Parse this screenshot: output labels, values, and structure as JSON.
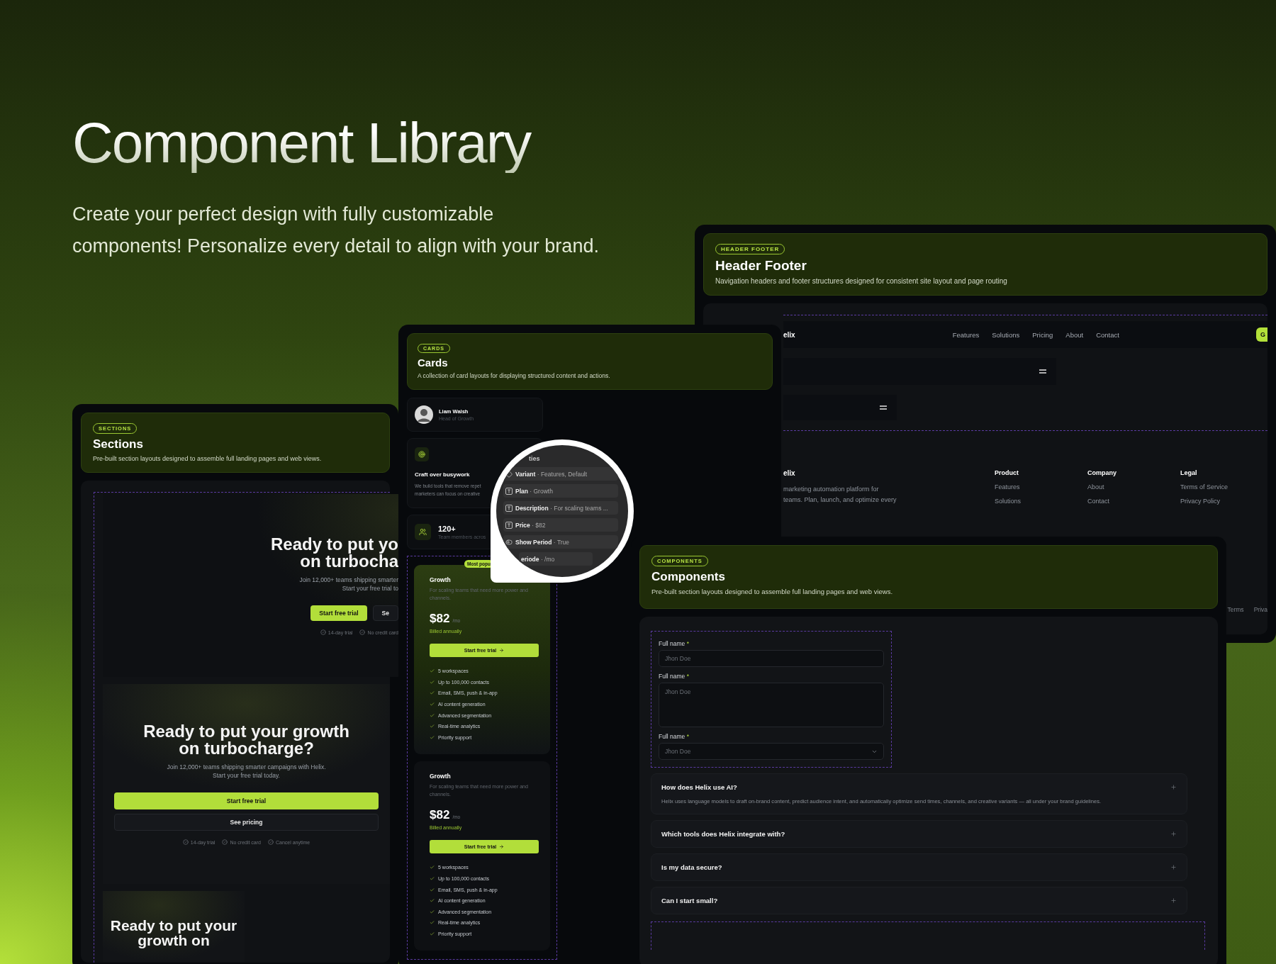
{
  "hero": {
    "title": "Component Library",
    "subtitle": [
      "Create your perfect design with fully customizable",
      "components! Personalize every detail to align with your brand."
    ]
  },
  "header_footer": {
    "badge": "HEADER FOOTER",
    "title": "Header Footer",
    "description": "Navigation headers and footer structures designed for consistent site layout and page routing",
    "nav": {
      "brand": "elix",
      "links": [
        "Features",
        "Solutions",
        "Pricing",
        "About",
        "Contact"
      ],
      "cta": "G"
    },
    "footer": {
      "brand": "elix",
      "description": [
        "marketing automation platform for",
        "teams. Plan, launch, and optimize every"
      ],
      "columns": [
        {
          "title": "Product",
          "links": [
            "Features",
            "Solutions"
          ]
        },
        {
          "title": "Company",
          "links": [
            "About",
            "Contact"
          ]
        },
        {
          "title": "Legal",
          "links": [
            "Terms of Service",
            "Privacy Policy"
          ]
        }
      ],
      "legal_links": [
        "Terms",
        "Priva"
      ]
    }
  },
  "sections": {
    "badge": "SECTIONS",
    "title": "Sections",
    "description": "Pre-built section layouts designed to assemble full landing pages and web views.",
    "blocks": [
      {
        "kind": "cropped",
        "headline": [
          "Ready to put yo",
          "on turbocha"
        ],
        "text": [
          "Join 12,000+ teams shipping smarter",
          "Start your free trial to"
        ],
        "buttons": [
          {
            "label": "Start free trial",
            "primary": true
          },
          {
            "label": "Se",
            "primary": false
          }
        ],
        "perks": [
          "14-day trial",
          "No credit card"
        ]
      },
      {
        "kind": "stacked",
        "headline": [
          "Ready to put your growth",
          "on turbocharge?"
        ],
        "text": [
          "Join 12,000+ teams shipping smarter campaigns with Helix.",
          "Start your free trial today."
        ],
        "buttons": [
          {
            "label": "Start free trial",
            "primary": true
          },
          {
            "label": "See pricing",
            "primary": false
          }
        ],
        "perks": [
          "14-day trial",
          "No credit card",
          "Cancel anytime"
        ]
      },
      {
        "kind": "narrow",
        "headline": [
          "Ready to put your",
          "growth on"
        ]
      }
    ]
  },
  "cards": {
    "badge": "CARDS",
    "title": "Cards",
    "description": "A collection of card layouts for displaying structured content and actions.",
    "profile": {
      "name": "Liam Walsh",
      "role": "Head of Growth"
    },
    "feature": {
      "title": "Craft over busywork",
      "text": [
        "We build tools that remove repet",
        "marketers can focus on creative"
      ]
    },
    "stat": {
      "value": "120+",
      "label": "Team members acros"
    },
    "plans": [
      {
        "featured": true,
        "badge": "Most popu",
        "name": "Growth",
        "description": "For scaling teams that need more power and channels.",
        "price": "$82",
        "period": "/mo",
        "billing": "Billed annually",
        "cta": "Start free trial",
        "features": [
          "5 workspaces",
          "Up to 100,000 contacts",
          "Email, SMS, push & in-app",
          "AI content generation",
          "Advanced segmentation",
          "Real-time analytics",
          "Priority support"
        ]
      },
      {
        "featured": false,
        "name": "Growth",
        "description": "For scaling teams that need more power and channels.",
        "price": "$82",
        "period": "/mo",
        "billing": "Billed annually",
        "cta": "Start free trial",
        "features": [
          "5 workspaces",
          "Up to 100,000 contacts",
          "Email, SMS, push & in-app",
          "AI content generation",
          "Advanced segmentation",
          "Real-time analytics",
          "Priority support"
        ]
      }
    ]
  },
  "magnifier": {
    "heading": "ties",
    "rows": [
      {
        "kind": "variant",
        "text": "**Variant** · Features, Default"
      },
      {
        "kind": "text",
        "text": "**Plan** · Growth"
      },
      {
        "kind": "text",
        "text": "**Description** · For scaling teams ..."
      },
      {
        "kind": "text",
        "text": "**Price** · $82"
      },
      {
        "kind": "toggle",
        "text": "**Show Period** · True"
      },
      {
        "kind": "cut",
        "text": "**eriode** · /mo"
      }
    ]
  },
  "components": {
    "badge": "COMPONENTS",
    "title": "Components",
    "description": "Pre-built section layouts designed to assemble full landing pages and web views.",
    "fields": [
      {
        "kind": "input",
        "label": "Full name",
        "mark": "*",
        "placeholder": "Jhon Doe"
      },
      {
        "kind": "textarea",
        "label": "Full name",
        "mark": "*",
        "placeholder": "Jhon Doe"
      },
      {
        "kind": "select",
        "label": "Full name",
        "mark": "*",
        "placeholder": "Jhon Doe"
      }
    ],
    "faq": [
      {
        "question": "How does Helix use AI?",
        "answer": "Helix uses language models to draft on-brand content, predict audience intent, and automatically optimize send times, channels, and creative variants — all under your brand guidelines."
      },
      {
        "question": "Which tools does Helix integrate with?"
      },
      {
        "question": "Is my data secure?"
      },
      {
        "question": "Can I start small?"
      }
    ]
  }
}
